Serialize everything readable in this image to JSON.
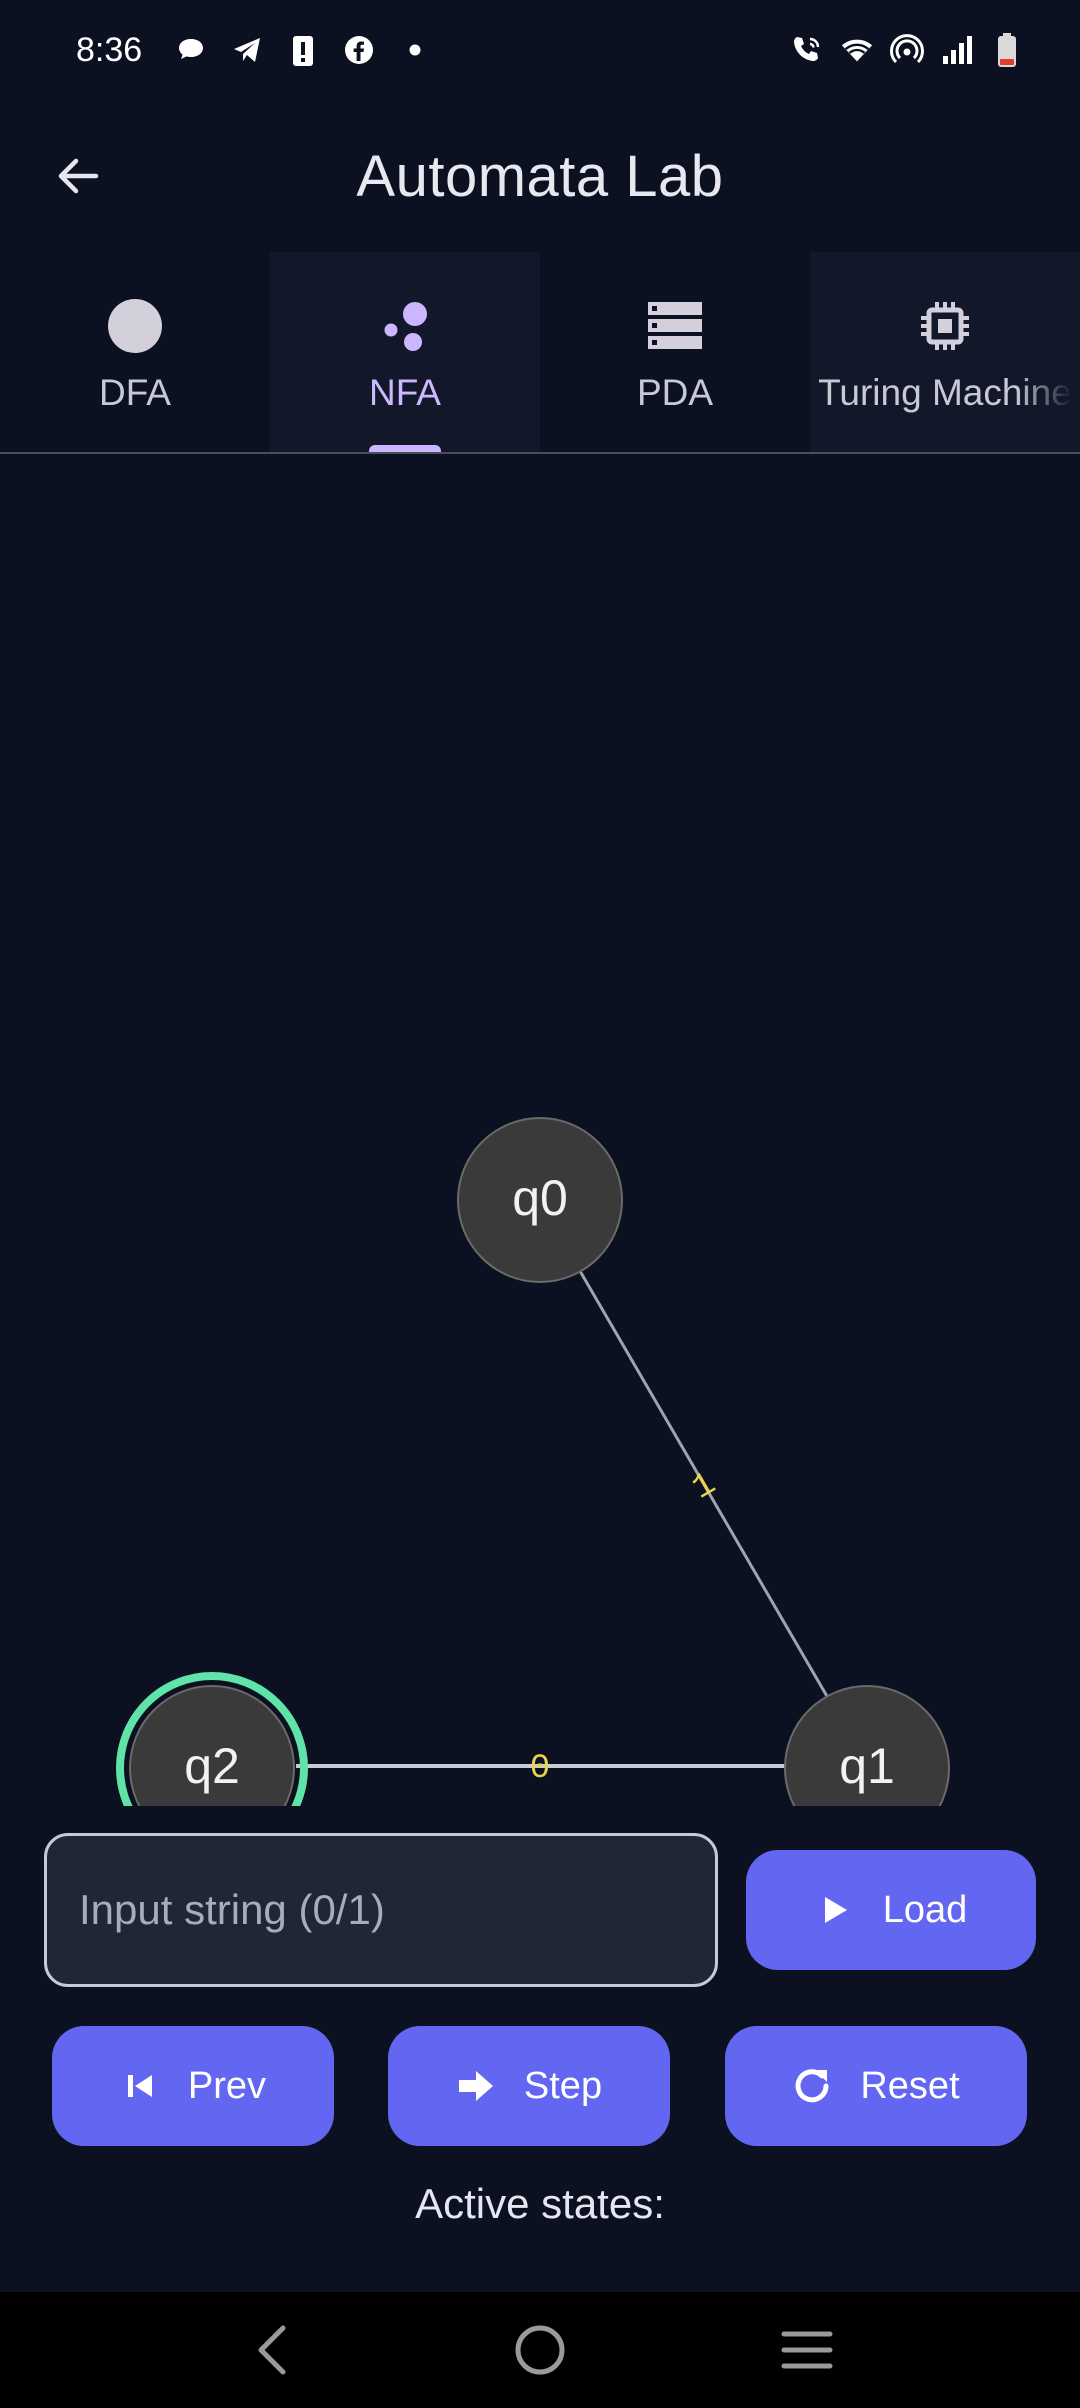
{
  "status_bar": {
    "time": "8:36",
    "left_icons": [
      "chat-bubble-icon",
      "telegram-icon",
      "battery-alert-icon",
      "facebook-icon",
      "dot-icon"
    ],
    "right_icons": [
      "wifi-call-icon",
      "wifi-icon",
      "hotspot-icon",
      "signal-icon",
      "battery-low-icon"
    ]
  },
  "app_bar": {
    "title": "Automata Lab",
    "back_icon": "arrow-back-icon"
  },
  "tabs": [
    {
      "label": "DFA",
      "icon": "circle-icon",
      "active": false
    },
    {
      "label": "NFA",
      "icon": "bubbles-icon",
      "active": true
    },
    {
      "label": "PDA",
      "icon": "stack-icon",
      "active": false
    },
    {
      "label": "Turing Machine",
      "icon": "chip-icon",
      "active": false
    }
  ],
  "graph": {
    "states": [
      {
        "label": "q0",
        "accepting": false
      },
      {
        "label": "q1",
        "accepting": false
      },
      {
        "label": "q2",
        "accepting": true
      }
    ],
    "transitions": [
      {
        "from": "q0",
        "to": "q1",
        "symbol": "1"
      },
      {
        "from": "q1",
        "to": "q2",
        "symbol": "0"
      }
    ],
    "colors": {
      "node_fill": "#3a3a3a",
      "edge": "#9ea3ad",
      "edge_label": "#e8d44d",
      "accept_ring": "#5fe3a8"
    }
  },
  "controls": {
    "input_placeholder": "Input string (0/1)",
    "input_value": "",
    "load_label": "Load",
    "prev_label": "Prev",
    "step_label": "Step",
    "reset_label": "Reset",
    "active_states_label": "Active states:",
    "accent": "#6366f1"
  },
  "nav_bar": {
    "icons": [
      "nav-back-icon",
      "nav-home-icon",
      "nav-recents-icon"
    ]
  }
}
